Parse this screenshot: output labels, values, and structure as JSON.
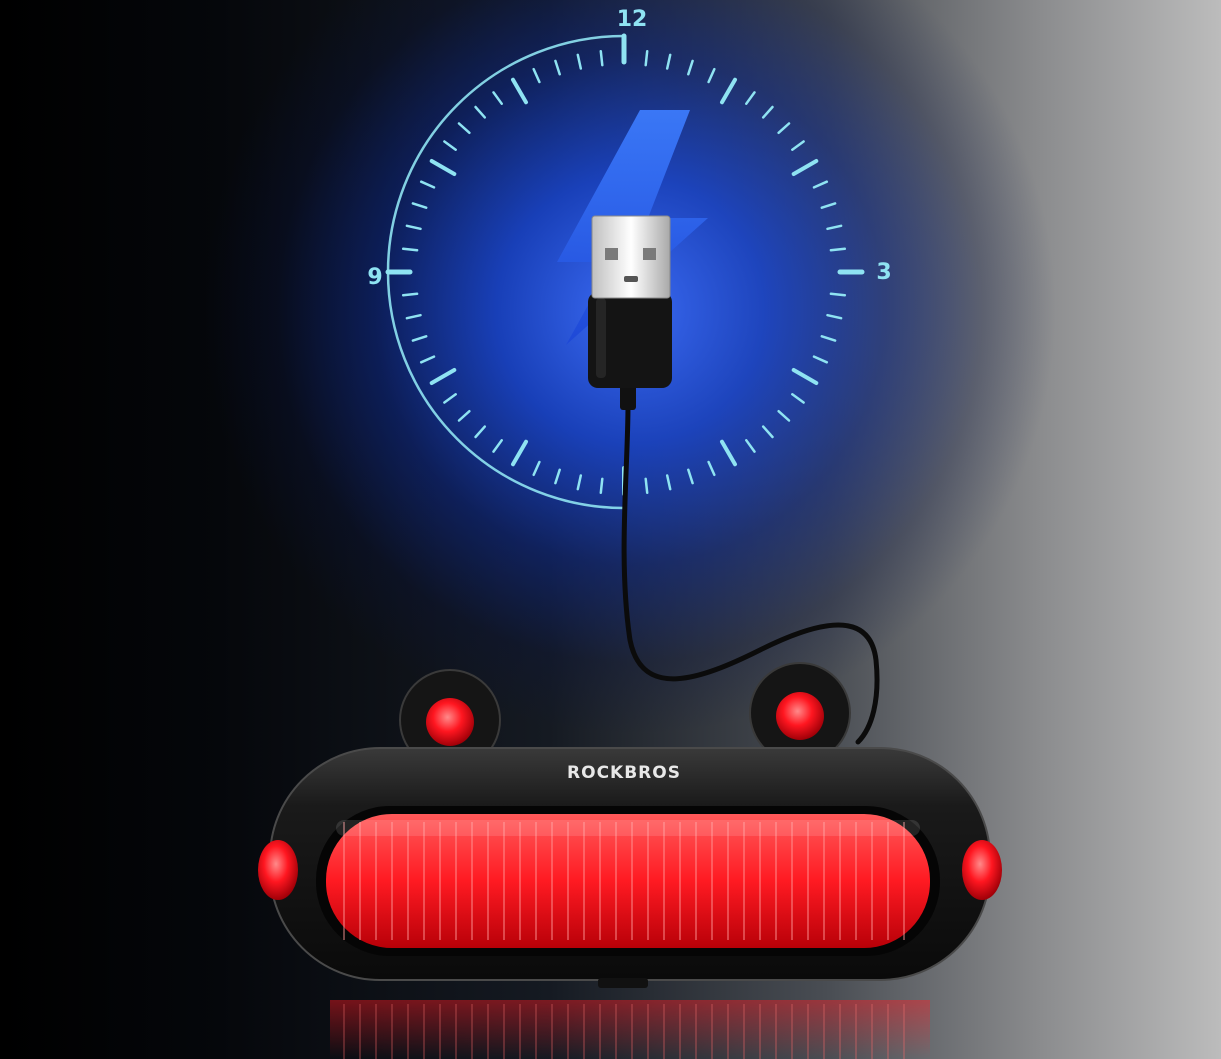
{
  "clock": {
    "numerals": {
      "twelve": "12",
      "three": "3",
      "nine": "9"
    },
    "tick_color": "#8fe3f2",
    "glow_color": "#2f5bff"
  },
  "product": {
    "brand": "ROCKBROS",
    "light_color": "#ff1a22",
    "body_color": "#111111"
  },
  "icons": {
    "charging": "lightning-bolt-icon",
    "connector": "usb-plug-icon"
  }
}
